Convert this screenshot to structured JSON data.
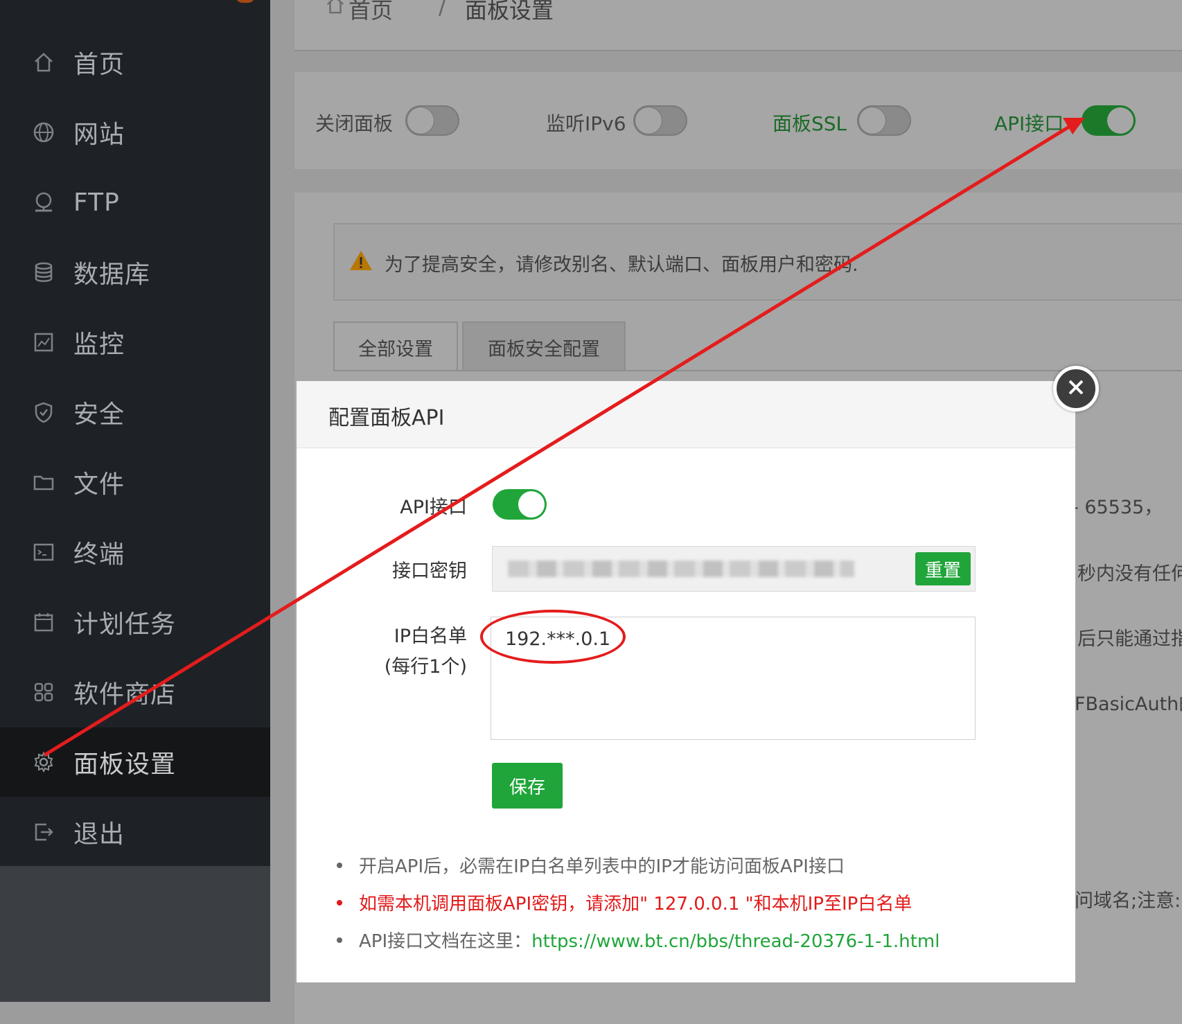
{
  "sidebar": {
    "items": [
      {
        "label": "首页",
        "icon": "home-icon"
      },
      {
        "label": "网站",
        "icon": "globe-icon"
      },
      {
        "label": "FTP",
        "icon": "ftp-icon"
      },
      {
        "label": "数据库",
        "icon": "database-icon"
      },
      {
        "label": "监控",
        "icon": "monitor-icon"
      },
      {
        "label": "安全",
        "icon": "shield-icon"
      },
      {
        "label": "文件",
        "icon": "folder-icon"
      },
      {
        "label": "终端",
        "icon": "terminal-icon"
      },
      {
        "label": "计划任务",
        "icon": "calendar-icon"
      },
      {
        "label": "软件商店",
        "icon": "grid-icon"
      },
      {
        "label": "面板设置",
        "icon": "gear-icon",
        "active": true
      },
      {
        "label": "退出",
        "icon": "logout-icon"
      }
    ]
  },
  "breadcrumb": {
    "home": "首页",
    "separator": "/",
    "current": "面板设置"
  },
  "toggles": [
    {
      "label": "关闭面板",
      "on": false
    },
    {
      "label": "监听IPv6",
      "on": false
    },
    {
      "label": "面板SSL",
      "on": false
    },
    {
      "label": "API接口",
      "on": true
    }
  ],
  "alert": {
    "text": "为了提高安全，请修改别名、默认端口、面板用户和密码."
  },
  "tabs": [
    "全部设置",
    "面板安全配置"
  ],
  "background_fragments": {
    "port_hint": "- 65535，",
    "port_hint_red": "注意",
    "timeout_hint": "秒内没有任何",
    "bind_hint": "后只能通过指定",
    "auth_hint": "FBasicAuth的",
    "domain_hint": "问域名;注意:"
  },
  "modal": {
    "title": "配置面板API",
    "api_label": "API接口",
    "api_enabled": true,
    "key_label": "接口密钥",
    "reset_label": "重置",
    "ip_label": "IP白名单",
    "ip_sublabel": "(每行1个)",
    "ip_value": "192.***.0.1",
    "save_label": "保存",
    "tips": [
      {
        "text": "开启API后，必需在IP白名单列表中的IP才能访问面板API接口",
        "style": "normal"
      },
      {
        "text": "如需本机调用面板API密钥，请添加\" 127.0.0.1 \"和本机IP至IP白名单",
        "style": "red"
      },
      {
        "text": "API接口文档在这里：",
        "link": "https://www.bt.cn/bbs/thread-20376-1-1.html",
        "style": "normal"
      }
    ]
  },
  "colors": {
    "accent": "#20a53a",
    "warn": "#e21a1a",
    "sidebar": "#1e2226"
  }
}
